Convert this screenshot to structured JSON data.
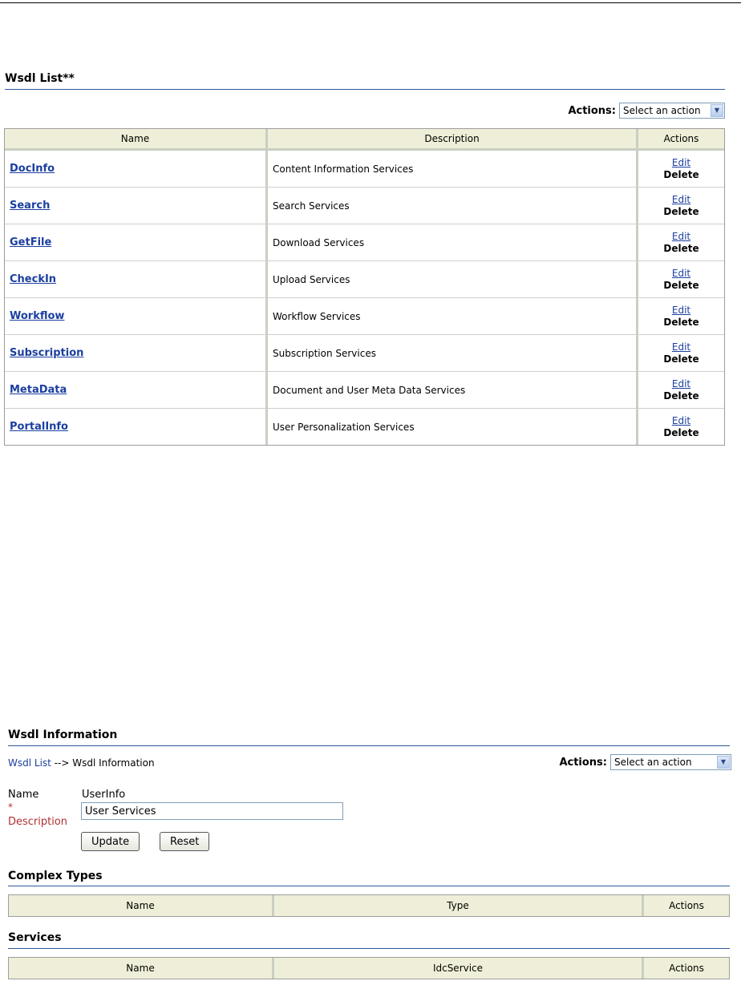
{
  "wsdl_list": {
    "title": "Wsdl List**",
    "actions_label": "Actions:",
    "actions_select": "Select an action",
    "columns": [
      "Name",
      "Description",
      "Actions"
    ],
    "rows": [
      {
        "name": "DocInfo",
        "description": "Content Information Services",
        "edit": "Edit",
        "delete": "Delete"
      },
      {
        "name": "Search",
        "description": "Search Services",
        "edit": "Edit",
        "delete": "Delete"
      },
      {
        "name": "GetFile",
        "description": "Download Services",
        "edit": "Edit",
        "delete": "Delete"
      },
      {
        "name": "CheckIn",
        "description": "Upload Services",
        "edit": "Edit",
        "delete": "Delete"
      },
      {
        "name": "Workflow",
        "description": "Workflow Services",
        "edit": "Edit",
        "delete": "Delete"
      },
      {
        "name": "Subscription",
        "description": "Subscription Services",
        "edit": "Edit",
        "delete": "Delete"
      },
      {
        "name": "MetaData",
        "description": "Document and User Meta Data Services",
        "edit": "Edit",
        "delete": "Delete"
      },
      {
        "name": "PortalInfo",
        "description": "User Personalization Services",
        "edit": "Edit",
        "delete": "Delete"
      }
    ]
  },
  "wsdl_info": {
    "title": "Wsdl Information",
    "breadcrumb_link": "Wsdl List",
    "breadcrumb_rest": " --> Wsdl Information",
    "actions_label": "Actions:",
    "actions_select": "Select an action",
    "name_label": "Name",
    "name_value": "UserInfo",
    "required_mark": "*",
    "description_label": "Description",
    "description_value": "User Services",
    "update_button": "Update",
    "reset_button": "Reset"
  },
  "complex_types": {
    "title": "Complex Types",
    "columns": [
      "Name",
      "Type",
      "Actions"
    ]
  },
  "services": {
    "title": "Services",
    "columns": [
      "Name",
      "IdcService",
      "Actions"
    ]
  }
}
